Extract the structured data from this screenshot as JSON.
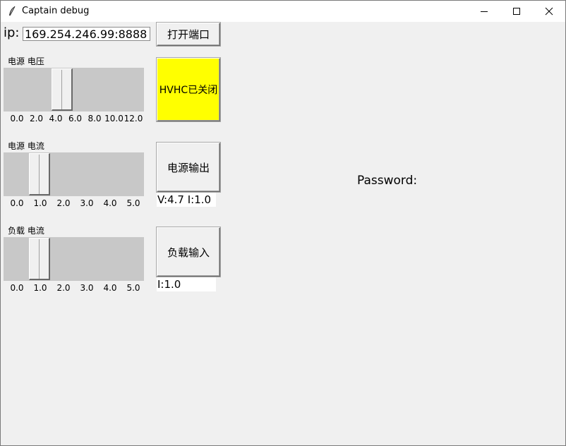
{
  "window": {
    "title": "Captain debug",
    "controls": {
      "minimize": "minimize",
      "maximize": "maximize",
      "close": "close"
    }
  },
  "connection": {
    "ip_label": "ip:",
    "ip_value": "169.254.246.99:8888",
    "open_port_button": "打开端口"
  },
  "hvhc": {
    "button_label": "HVHC已关闭",
    "button_color": "#ffff00"
  },
  "psu_voltage": {
    "label": "电源 电压",
    "ticks": [
      "0.0",
      "2.0",
      "4.0",
      "6.0",
      "8.0",
      "10.0",
      "12.0"
    ],
    "min": 0,
    "max": 12,
    "value": 4.7
  },
  "psu_current": {
    "label": "电源 电流",
    "ticks": [
      "0.0",
      "1.0",
      "2.0",
      "3.0",
      "4.0",
      "5.0"
    ],
    "min": 0,
    "max": 5,
    "value": 1.0,
    "output_button": "电源输出",
    "readout": "V:4.7  I:1.0"
  },
  "load_current": {
    "label": "负载 电流",
    "ticks": [
      "0.0",
      "1.0",
      "2.0",
      "3.0",
      "4.0",
      "5.0"
    ],
    "min": 0,
    "max": 5,
    "value": 1.0,
    "input_button": "负载输入",
    "readout": "I:1.0"
  },
  "password": {
    "label": "Password:"
  }
}
